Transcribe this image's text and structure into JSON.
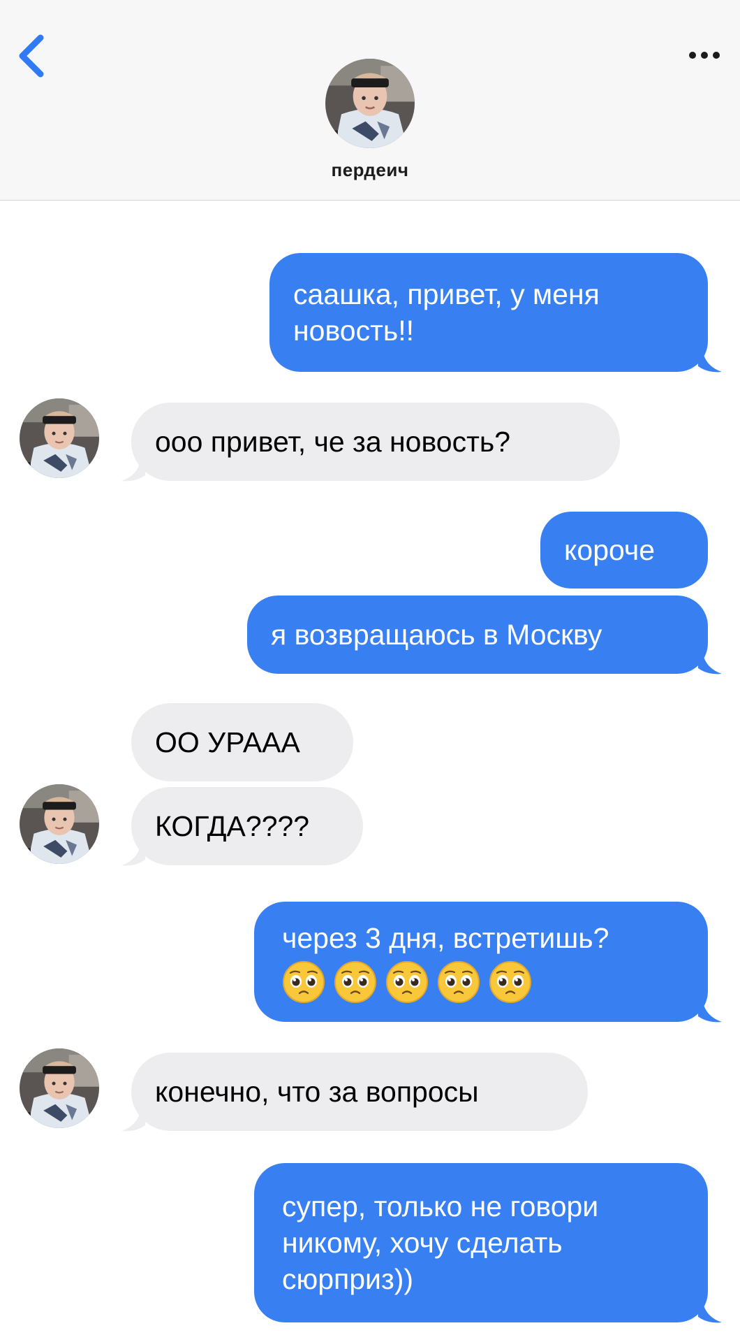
{
  "header": {
    "contact_name": "пердеич",
    "back_icon": "chevron-left-icon",
    "more_icon": "ellipsis-icon"
  },
  "messages": [
    {
      "sender": "me",
      "text": "саашка, привет, у меня новость!!"
    },
    {
      "sender": "contact",
      "text": "ооо привет, че за новость?"
    },
    {
      "sender": "me",
      "text": "короче"
    },
    {
      "sender": "me",
      "text": "я возвращаюсь в Москву"
    },
    {
      "sender": "contact",
      "text": "ОО УРААА"
    },
    {
      "sender": "contact",
      "text": "КОГДА????"
    },
    {
      "sender": "me",
      "text": "через 3 дня, встретишь?",
      "emoji": "pleading-face-icon",
      "emoji_count": 5
    },
    {
      "sender": "contact",
      "text": "конечно, что за вопросы"
    },
    {
      "sender": "me",
      "text": "супер, только не говори никому, хочу сделать сюрприз))"
    }
  ],
  "colors": {
    "outgoing_bubble": "#3880f2",
    "incoming_bubble": "#ededf0",
    "header_bg": "#f7f7f8",
    "accent": "#2f7bf5"
  }
}
